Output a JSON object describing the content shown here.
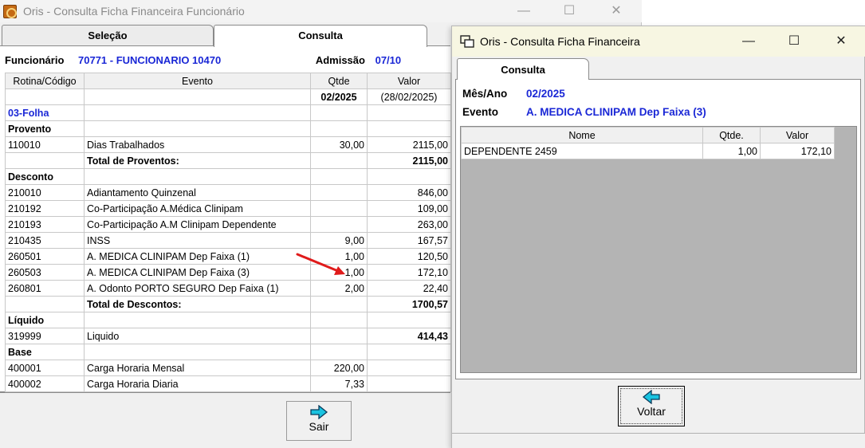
{
  "back_window": {
    "title": "Oris - Consulta Ficha Financeira Funcionário",
    "controls": {
      "minimize": "—",
      "maximize": "☐",
      "close": "✕"
    },
    "tabs": [
      "Seleção",
      "Consulta"
    ],
    "funcionario_label": "Funcionário",
    "funcionario_value": "70771 - FUNCIONARIO 10470",
    "admissao_label": "Admissão",
    "admissao_value": "07/10",
    "columns": [
      "Rotina/Código",
      "Evento",
      "Qtde",
      "Valor"
    ],
    "period_row": {
      "qtde": "02/2025",
      "valor": "(28/02/2025)"
    },
    "rows": [
      {
        "code": "03-Folha",
        "evento": "",
        "qtde": "",
        "valor": "",
        "style": "sec"
      },
      {
        "code": "Provento",
        "evento": "",
        "qtde": "",
        "valor": "",
        "style": "b"
      },
      {
        "code": "110010",
        "evento": "Dias Trabalhados",
        "qtde": "30,00",
        "valor": "2115,00",
        "style": ""
      },
      {
        "code": "",
        "evento": "Total de Proventos:",
        "qtde": "",
        "valor": "2115,00",
        "style": "total"
      },
      {
        "code": "Desconto",
        "evento": "",
        "qtde": "",
        "valor": "",
        "style": "b"
      },
      {
        "code": "210010",
        "evento": "Adiantamento Quinzenal",
        "qtde": "",
        "valor": "846,00",
        "style": ""
      },
      {
        "code": "210192",
        "evento": "Co-Participação A.Médica Clinipam",
        "qtde": "",
        "valor": "109,00",
        "style": ""
      },
      {
        "code": "210193",
        "evento": "Co-Participação A.M Clinipam Dependente",
        "qtde": "",
        "valor": "263,00",
        "style": ""
      },
      {
        "code": "210435",
        "evento": "INSS",
        "qtde": "9,00",
        "valor": "167,57",
        "style": ""
      },
      {
        "code": "260501",
        "evento": "A. MEDICA CLINIPAM Dep Faixa (1)",
        "qtde": "1,00",
        "valor": "120,50",
        "style": ""
      },
      {
        "code": "260503",
        "evento": "A. MEDICA CLINIPAM Dep Faixa (3)",
        "qtde": "1,00",
        "valor": "172,10",
        "style": ""
      },
      {
        "code": "260801",
        "evento": "A. Odonto PORTO SEGURO Dep Faixa (1)",
        "qtde": "2,00",
        "valor": "22,40",
        "style": ""
      },
      {
        "code": "",
        "evento": "Total de Descontos:",
        "qtde": "",
        "valor": "1700,57",
        "style": "total"
      },
      {
        "code": "Líquido",
        "evento": "",
        "qtde": "",
        "valor": "",
        "style": "b"
      },
      {
        "code": "319999",
        "evento": "Liquido",
        "qtde": "",
        "valor": "414,43",
        "style": "liq"
      },
      {
        "code": "Base",
        "evento": "",
        "qtde": "",
        "valor": "",
        "style": "b"
      },
      {
        "code": "400001",
        "evento": "Carga Horaria Mensal",
        "qtde": "220,00",
        "valor": "",
        "style": ""
      },
      {
        "code": "400002",
        "evento": "Carga Horaria Diaria",
        "qtde": "7,33",
        "valor": "",
        "style": ""
      }
    ],
    "sair_label": "Sair",
    "sair_icon": "right-arrow-icon"
  },
  "front_window": {
    "title": "Oris - Consulta Ficha Financeira",
    "controls": {
      "minimize": "—",
      "maximize": "☐",
      "close": "✕"
    },
    "tab": "Consulta",
    "mes_ano_label": "Mês/Ano",
    "mes_ano_value": "02/2025",
    "evento_label": "Evento",
    "evento_value": "A. MEDICA CLINIPAM Dep Faixa (3)",
    "columns": [
      "Nome",
      "Qtde.",
      "Valor"
    ],
    "rows": [
      {
        "nome": "DEPENDENTE 2459",
        "qtde": "1,00",
        "valor": "172,10"
      }
    ],
    "voltar_label": "Voltar",
    "voltar_icon": "left-arrow-icon"
  },
  "colors": {
    "accent_blue": "#1a27d6",
    "annotation_red": "#e01b1b",
    "arrow_cyan": "#19c3e0"
  }
}
